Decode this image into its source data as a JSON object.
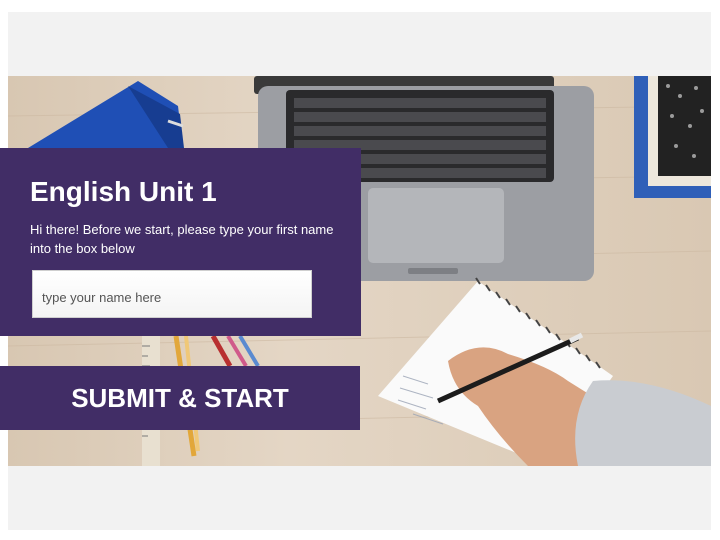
{
  "lesson": {
    "title": "English Unit 1",
    "instructions": "Hi there! Before we start, please type your first name into the box below",
    "name_field": {
      "placeholder": "type your name here",
      "value": ""
    },
    "submit_label": "SUBMIT & START"
  },
  "background_image": "student-writing-with-laptop-photo",
  "colors": {
    "panel": "#412d66",
    "slide_bg": "#f2f2f2",
    "text": "#ffffff"
  }
}
